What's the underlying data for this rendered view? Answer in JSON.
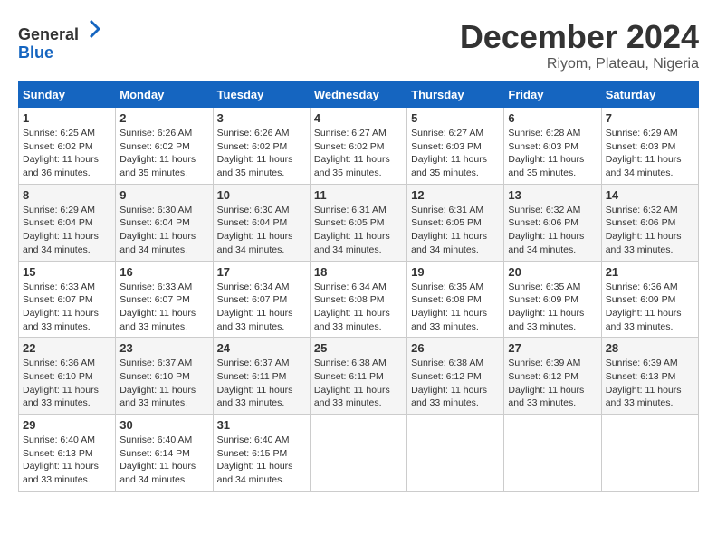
{
  "header": {
    "logo_general": "General",
    "logo_blue": "Blue",
    "month_title": "December 2024",
    "location": "Riyom, Plateau, Nigeria"
  },
  "days_of_week": [
    "Sunday",
    "Monday",
    "Tuesday",
    "Wednesday",
    "Thursday",
    "Friday",
    "Saturday"
  ],
  "weeks": [
    [
      {
        "day": "1",
        "info": "Sunrise: 6:25 AM\nSunset: 6:02 PM\nDaylight: 11 hours and 36 minutes."
      },
      {
        "day": "2",
        "info": "Sunrise: 6:26 AM\nSunset: 6:02 PM\nDaylight: 11 hours and 35 minutes."
      },
      {
        "day": "3",
        "info": "Sunrise: 6:26 AM\nSunset: 6:02 PM\nDaylight: 11 hours and 35 minutes."
      },
      {
        "day": "4",
        "info": "Sunrise: 6:27 AM\nSunset: 6:02 PM\nDaylight: 11 hours and 35 minutes."
      },
      {
        "day": "5",
        "info": "Sunrise: 6:27 AM\nSunset: 6:03 PM\nDaylight: 11 hours and 35 minutes."
      },
      {
        "day": "6",
        "info": "Sunrise: 6:28 AM\nSunset: 6:03 PM\nDaylight: 11 hours and 35 minutes."
      },
      {
        "day": "7",
        "info": "Sunrise: 6:29 AM\nSunset: 6:03 PM\nDaylight: 11 hours and 34 minutes."
      }
    ],
    [
      {
        "day": "8",
        "info": "Sunrise: 6:29 AM\nSunset: 6:04 PM\nDaylight: 11 hours and 34 minutes."
      },
      {
        "day": "9",
        "info": "Sunrise: 6:30 AM\nSunset: 6:04 PM\nDaylight: 11 hours and 34 minutes."
      },
      {
        "day": "10",
        "info": "Sunrise: 6:30 AM\nSunset: 6:04 PM\nDaylight: 11 hours and 34 minutes."
      },
      {
        "day": "11",
        "info": "Sunrise: 6:31 AM\nSunset: 6:05 PM\nDaylight: 11 hours and 34 minutes."
      },
      {
        "day": "12",
        "info": "Sunrise: 6:31 AM\nSunset: 6:05 PM\nDaylight: 11 hours and 34 minutes."
      },
      {
        "day": "13",
        "info": "Sunrise: 6:32 AM\nSunset: 6:06 PM\nDaylight: 11 hours and 34 minutes."
      },
      {
        "day": "14",
        "info": "Sunrise: 6:32 AM\nSunset: 6:06 PM\nDaylight: 11 hours and 33 minutes."
      }
    ],
    [
      {
        "day": "15",
        "info": "Sunrise: 6:33 AM\nSunset: 6:07 PM\nDaylight: 11 hours and 33 minutes."
      },
      {
        "day": "16",
        "info": "Sunrise: 6:33 AM\nSunset: 6:07 PM\nDaylight: 11 hours and 33 minutes."
      },
      {
        "day": "17",
        "info": "Sunrise: 6:34 AM\nSunset: 6:07 PM\nDaylight: 11 hours and 33 minutes."
      },
      {
        "day": "18",
        "info": "Sunrise: 6:34 AM\nSunset: 6:08 PM\nDaylight: 11 hours and 33 minutes."
      },
      {
        "day": "19",
        "info": "Sunrise: 6:35 AM\nSunset: 6:08 PM\nDaylight: 11 hours and 33 minutes."
      },
      {
        "day": "20",
        "info": "Sunrise: 6:35 AM\nSunset: 6:09 PM\nDaylight: 11 hours and 33 minutes."
      },
      {
        "day": "21",
        "info": "Sunrise: 6:36 AM\nSunset: 6:09 PM\nDaylight: 11 hours and 33 minutes."
      }
    ],
    [
      {
        "day": "22",
        "info": "Sunrise: 6:36 AM\nSunset: 6:10 PM\nDaylight: 11 hours and 33 minutes."
      },
      {
        "day": "23",
        "info": "Sunrise: 6:37 AM\nSunset: 6:10 PM\nDaylight: 11 hours and 33 minutes."
      },
      {
        "day": "24",
        "info": "Sunrise: 6:37 AM\nSunset: 6:11 PM\nDaylight: 11 hours and 33 minutes."
      },
      {
        "day": "25",
        "info": "Sunrise: 6:38 AM\nSunset: 6:11 PM\nDaylight: 11 hours and 33 minutes."
      },
      {
        "day": "26",
        "info": "Sunrise: 6:38 AM\nSunset: 6:12 PM\nDaylight: 11 hours and 33 minutes."
      },
      {
        "day": "27",
        "info": "Sunrise: 6:39 AM\nSunset: 6:12 PM\nDaylight: 11 hours and 33 minutes."
      },
      {
        "day": "28",
        "info": "Sunrise: 6:39 AM\nSunset: 6:13 PM\nDaylight: 11 hours and 33 minutes."
      }
    ],
    [
      {
        "day": "29",
        "info": "Sunrise: 6:40 AM\nSunset: 6:13 PM\nDaylight: 11 hours and 33 minutes."
      },
      {
        "day": "30",
        "info": "Sunrise: 6:40 AM\nSunset: 6:14 PM\nDaylight: 11 hours and 34 minutes."
      },
      {
        "day": "31",
        "info": "Sunrise: 6:40 AM\nSunset: 6:15 PM\nDaylight: 11 hours and 34 minutes."
      },
      {
        "day": "",
        "info": ""
      },
      {
        "day": "",
        "info": ""
      },
      {
        "day": "",
        "info": ""
      },
      {
        "day": "",
        "info": ""
      }
    ]
  ]
}
